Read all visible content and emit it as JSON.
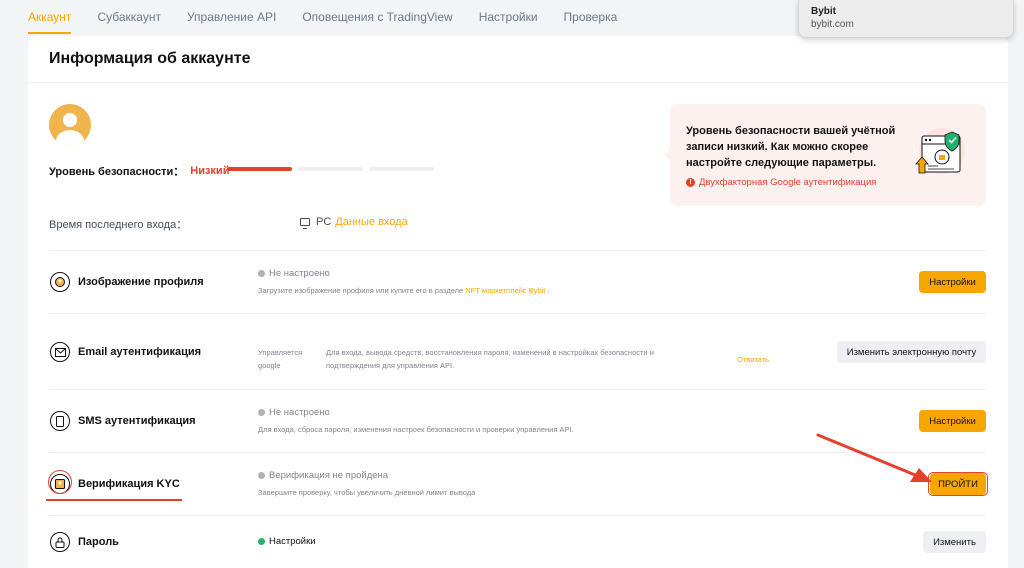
{
  "tabs": [
    {
      "label": "Аккаунт",
      "active": true
    },
    {
      "label": "Субаккаунт",
      "active": false
    },
    {
      "label": "Управление API",
      "active": false
    },
    {
      "label": "Оповещения с TradingView",
      "active": false
    },
    {
      "label": "Настройки",
      "active": false
    },
    {
      "label": "Проверка",
      "active": false
    }
  ],
  "popup": {
    "title": "Bybit",
    "url": "bybit.com"
  },
  "page_title": "Информация об аккаунте",
  "security": {
    "label": "Уровень безопасности：",
    "value": "Низкий",
    "level_filled": 1,
    "level_total": 4
  },
  "last_login": {
    "label": "Время последнего входа：",
    "device": "PC",
    "link": "Данные входа"
  },
  "warning": {
    "text": "Уровень безопасности вашей учётной записи низкий. Как можно скорее настройте следующие параметры.",
    "link": "Двухфакторная Google аутентификация"
  },
  "rows": {
    "profile": {
      "title": "Изображение профиля",
      "status": "Не настроено",
      "desc_prefix": "Загрузите изображение профиля или купите его в разделе ",
      "desc_link": "NFT маркетплейс Bybit",
      "desc_suffix": " .",
      "button": "Настройки"
    },
    "email": {
      "title": "Email аутентификация",
      "managed_line1": "Управляется",
      "managed_line2": "google",
      "desc_line1": "Для входа, вывода средств, восстановления пароля, изменений в настройках безопасности и",
      "desc_line2": "подтверждения для управления API.",
      "unbind": "Отвязать",
      "button": "Изменить электронную почту"
    },
    "sms": {
      "title": "SMS аутентификация",
      "status": "Не настроено",
      "desc": "Для входа, сброса пароля, изменения настроек безопасности и проверки управления API.",
      "button": "Настройки"
    },
    "kyc": {
      "title": "Верификация KYC",
      "status": "Верификация не пройдена",
      "desc": "Завершите проверку, чтобы увеличить дневной лимит вывода",
      "button": "ПРОЙТИ"
    },
    "password": {
      "title": "Пароль",
      "status": "Настройки",
      "button": "Изменить"
    }
  },
  "colors": {
    "accent": "#f7a600",
    "danger": "#e2412c",
    "success": "#20b26c"
  }
}
